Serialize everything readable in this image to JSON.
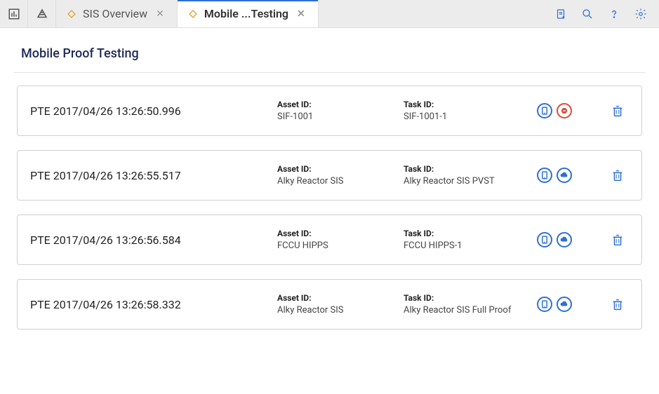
{
  "tabs": [
    {
      "label": "SIS Overview",
      "active": false
    },
    {
      "label": "Mobile ...Testing",
      "active": true
    }
  ],
  "page": {
    "title": "Mobile Proof Testing",
    "asset_label": "Asset ID:",
    "task_label": "Task ID:"
  },
  "items": [
    {
      "title": "PTE 2017/04/26 13:26:50.996",
      "asset": "SIF-1001",
      "task": "SIF-1001-1",
      "sync_state": "error"
    },
    {
      "title": "PTE 2017/04/26 13:26:55.517",
      "asset": "Alky Reactor SIS",
      "task": "Alky Reactor SIS PVST",
      "sync_state": "cloud"
    },
    {
      "title": "PTE 2017/04/26 13:26:56.584",
      "asset": "FCCU HIPPS",
      "task": "FCCU HIPPS-1",
      "sync_state": "cloud"
    },
    {
      "title": "PTE 2017/04/26 13:26:58.332",
      "asset": "Alky Reactor SIS",
      "task": "Alky Reactor SIS Full Proof",
      "sync_state": "cloud"
    }
  ]
}
